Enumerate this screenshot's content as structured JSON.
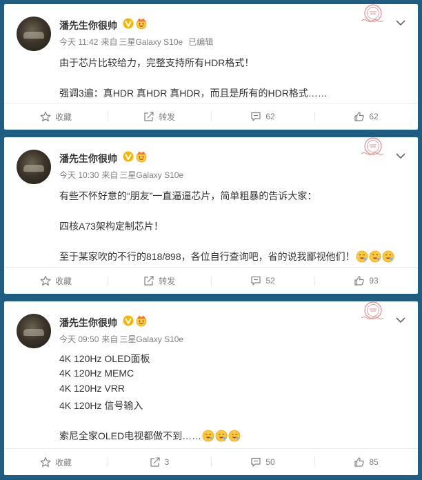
{
  "posts": [
    {
      "username": "潘先生你很帅",
      "time": "今天 11:42",
      "via_prefix": "来自",
      "via": "三星Galaxy S10e",
      "edited": "已编辑",
      "lines": [
        "由于芯片比较给力，完整支持所有HDR格式！",
        "强调3遍：真HDR 真HDR 真HDR，而且是所有的HDR格式……"
      ],
      "actions": {
        "favorite": "收藏",
        "repost": "转发",
        "comments": "62",
        "likes": "62"
      }
    },
    {
      "username": "潘先生你很帅",
      "time": "今天 10:30",
      "via_prefix": "来自",
      "via": "三星Galaxy S10e",
      "lines": [
        "有些不怀好意的“朋友”一直逼逼芯片，简单粗暴的告诉大家：",
        "四核A73架构定制芯片！",
        "至于某家吹的不行的818/898，各位自行查询吧，省的说我鄙视他们！"
      ],
      "actions": {
        "favorite": "收藏",
        "repost": "转发",
        "comments": "52",
        "likes": "93"
      }
    },
    {
      "username": "潘先生你很帅",
      "time": "今天 09:50",
      "via_prefix": "来自",
      "via": "三星Galaxy S10e",
      "lines": [
        "4K 120Hz OLED面板",
        "4K 120Hz MEMC",
        "4K 120Hz VRR",
        "4K 120Hz 信号输入",
        "索尼全家OLED电视都做不到……"
      ],
      "actions": {
        "favorite": "收藏",
        "repost": "3",
        "comments": "50",
        "likes": "85"
      }
    }
  ],
  "icons": {
    "verified": "verified-v-badge-icon",
    "member": "member-emoji-badge-icon",
    "stamp": "postmark-stamp-icon",
    "menu": "chevron-down-icon",
    "favorite": "star-icon",
    "repost": "repost-icon",
    "comment": "comment-icon",
    "like": "thumbs-up-icon",
    "emoji": "drooling-face-emoji-icon"
  },
  "colors": {
    "background": "#1f5d83",
    "badge": "#f7b500",
    "muted": "#808080",
    "stamp": "#e5898c"
  }
}
